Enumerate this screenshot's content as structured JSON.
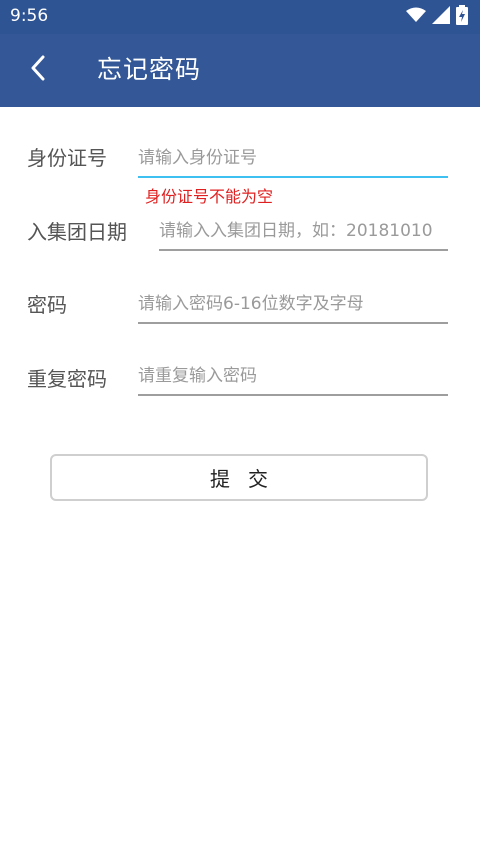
{
  "status_bar": {
    "time": "9:56",
    "icons": [
      "wifi-icon",
      "signal-icon",
      "battery-charging-icon"
    ]
  },
  "app_bar": {
    "title": "忘记密码",
    "back_icon": "chevron-left-icon",
    "color": "#335797"
  },
  "form": {
    "id_number": {
      "label": "身份证号",
      "placeholder": "请输入身份证号",
      "value": "",
      "error": "身份证号不能为空"
    },
    "join_date": {
      "label": "入集团日期",
      "placeholder": "请输入入集团日期，如：20181010",
      "value": ""
    },
    "password": {
      "label": "密码",
      "placeholder": "请输入密码6-16位数字及字母",
      "value": ""
    },
    "confirm_password": {
      "label": "重复密码",
      "placeholder": "请重复输入密码",
      "value": ""
    },
    "submit_label": "提交"
  },
  "colors": {
    "focus_underline": "#3ec0f0",
    "error": "#e02020"
  }
}
